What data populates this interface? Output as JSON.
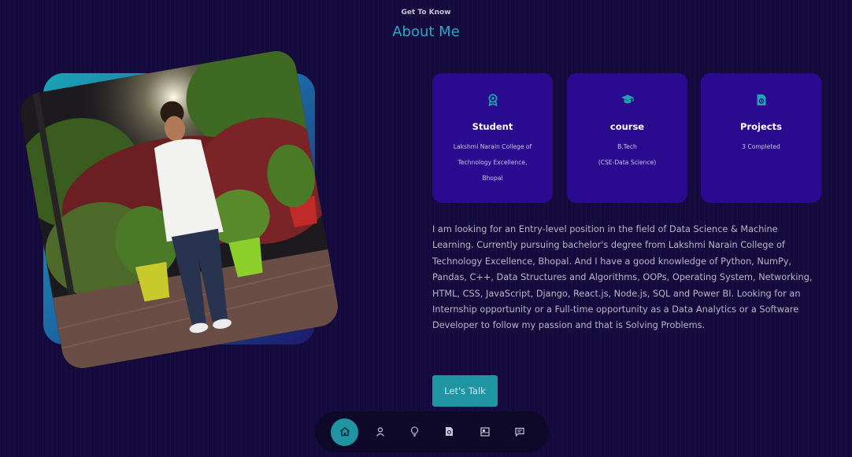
{
  "header": {
    "eyebrow": "Get To Know",
    "title": "About Me"
  },
  "cards": [
    {
      "icon": "award-icon",
      "title": "Student",
      "lines": [
        "Lakshmi Narain College of",
        "Technology Excellence,",
        "Bhopal"
      ]
    },
    {
      "icon": "graduation-cap-icon",
      "title": "course",
      "lines": [
        "B.Tech",
        "(CSE-Data Science)"
      ]
    },
    {
      "icon": "project-file-icon",
      "title": "Projects",
      "lines": [
        "3 Completed"
      ]
    }
  ],
  "about": {
    "text": "I am looking for an Entry-level position in the field of Data Science & Machine Learning. Currently pursuing bachelor's degree from Lakshmi Narain College of Technology Excellence, Bhopal. And I have a good knowledge of Python, NumPy, Pandas, C++, Data Structures and Algorithms, OOPs, Operating System, Networking, HTML, CSS, JavaScript, Django, React.js, Node.js, SQL and Power BI. Looking for an Internship opportunity or a Full-time opportunity as a Data Analytics or a Software Developer to follow my passion and that is Solving Problems.",
    "button_label": "Let's Talk"
  },
  "nav": {
    "items": [
      {
        "icon": "home-icon",
        "active": true
      },
      {
        "icon": "user-icon",
        "active": false
      },
      {
        "icon": "lightbulb-icon",
        "active": false
      },
      {
        "icon": "document-icon",
        "active": false
      },
      {
        "icon": "portfolio-icon",
        "active": false
      },
      {
        "icon": "message-icon",
        "active": false
      }
    ]
  },
  "colors": {
    "background": "#150a3d",
    "card": "#2a0a8f",
    "accent": "#1f95a3",
    "title_accent": "#2ea7c2"
  }
}
